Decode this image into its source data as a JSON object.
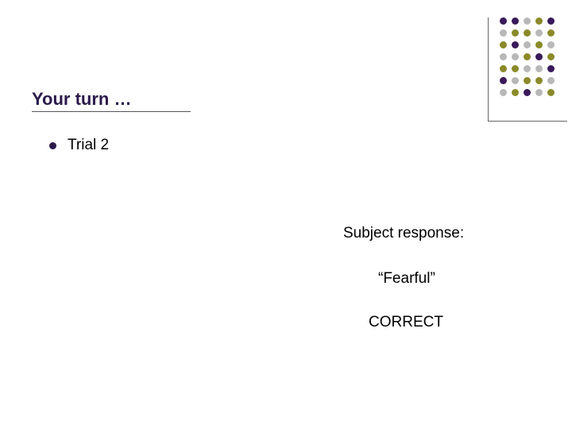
{
  "title": "Your turn …",
  "bullet": "Trial 2",
  "response": {
    "label": "Subject response:",
    "value": "“Fearful”",
    "status": "CORRECT"
  },
  "deco_colors": {
    "purple": "#3a1a5a",
    "olive": "#8a8a2a",
    "grey": "#b8b8b8"
  }
}
